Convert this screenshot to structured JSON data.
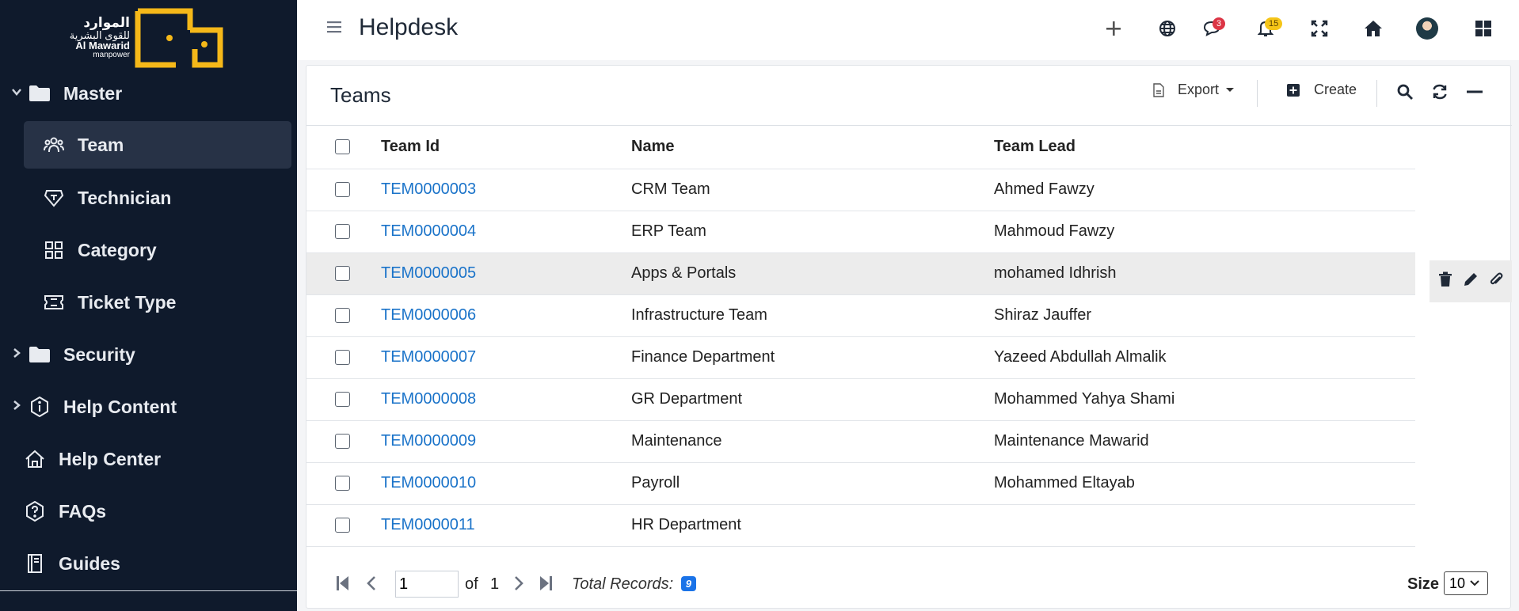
{
  "brand": {
    "ar_line1": "الموارد",
    "ar_line2": "للقوى البشرية",
    "en_line1": "Al Mawarid",
    "en_line2": "manpower",
    "accent": "#f5b819"
  },
  "sidebar": {
    "items": [
      {
        "label": "Master",
        "icon": "folder-icon",
        "expanded": true
      },
      {
        "label": "Team",
        "icon": "users-icon",
        "active": true
      },
      {
        "label": "Technician",
        "icon": "shield-icon"
      },
      {
        "label": "Category",
        "icon": "grid-icon"
      },
      {
        "label": "Ticket Type",
        "icon": "ticket-icon"
      },
      {
        "label": "Security",
        "icon": "folder-icon",
        "expanded": false
      },
      {
        "label": "Help Content",
        "icon": "info-icon",
        "expanded": false
      },
      {
        "label": "Help Center",
        "icon": "home-icon"
      },
      {
        "label": "FAQs",
        "icon": "question-icon"
      },
      {
        "label": "Guides",
        "icon": "book-icon"
      }
    ]
  },
  "header": {
    "title": "Helpdesk",
    "chat_count": "3",
    "notification_count": "15"
  },
  "panel": {
    "title": "Teams",
    "export_label": "Export",
    "create_label": "Create"
  },
  "table": {
    "columns": [
      "Team Id",
      "Name",
      "Team Lead"
    ],
    "rows": [
      {
        "id": "TEM0000003",
        "name": "CRM Team",
        "lead": "Ahmed Fawzy"
      },
      {
        "id": "TEM0000004",
        "name": "ERP Team",
        "lead": "Mahmoud Fawzy"
      },
      {
        "id": "TEM0000005",
        "name": "Apps & Portals",
        "lead": "mohamed Idhrish"
      },
      {
        "id": "TEM0000006",
        "name": "Infrastructure Team",
        "lead": "Shiraz Jauffer"
      },
      {
        "id": "TEM0000007",
        "name": "Finance Department",
        "lead": "Yazeed Abdullah Almalik"
      },
      {
        "id": "TEM0000008",
        "name": "GR Department",
        "lead": "Mohammed Yahya Shami"
      },
      {
        "id": "TEM0000009",
        "name": "Maintenance",
        "lead": "Maintenance Mawarid"
      },
      {
        "id": "TEM0000010",
        "name": "Payroll",
        "lead": "Mohammed Eltayab"
      },
      {
        "id": "TEM0000011",
        "name": "HR Department",
        "lead": ""
      }
    ]
  },
  "pager": {
    "page": "1",
    "of_label": "of",
    "total_pages": "1",
    "total_label": "Total Records:",
    "total_records": "9",
    "size_label": "Size",
    "size_value": "10"
  }
}
